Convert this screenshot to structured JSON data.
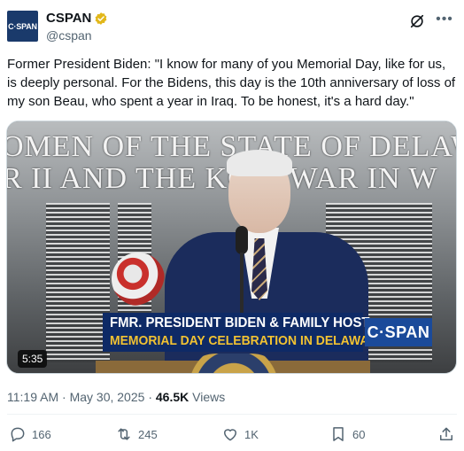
{
  "author": {
    "avatar_text": "C·SPAN",
    "display_name": "CSPAN",
    "handle": "@cspan",
    "verified_icon": "gold-verified-badge",
    "verified_color": "#e2b719"
  },
  "tweet": {
    "text": "Former President Biden: \"I know for many of you Memorial Day, like for us, is deeply personal. For the Bidens, this day is the 10th anniversary of loss of my son Beau, who spent a year in Iraq. To be honest, it's a hard day.\""
  },
  "media": {
    "wall_line1": "OMEN OF THE STATE OF DELAWA",
    "wall_line2": "R II AND THE KO    N WAR IN W",
    "lower_third_line1": "FMR. PRESIDENT BIDEN & FAMILY HOST",
    "lower_third_line2": "MEMORIAL DAY CELEBRATION IN DELAWARE",
    "network_logo": "C·SPAN",
    "duration": "5:35"
  },
  "meta": {
    "time": "11:19 AM",
    "date": "May 30, 2025",
    "views_count": "46.5K",
    "views_label": "Views"
  },
  "actions": {
    "replies": "166",
    "reposts": "245",
    "likes": "1K",
    "bookmarks": "60"
  },
  "colors": {
    "text": "#0f1419",
    "muted": "#536471",
    "lower_third_blue": "#0e2a66",
    "lower_third_yellow": "#f1c232"
  }
}
